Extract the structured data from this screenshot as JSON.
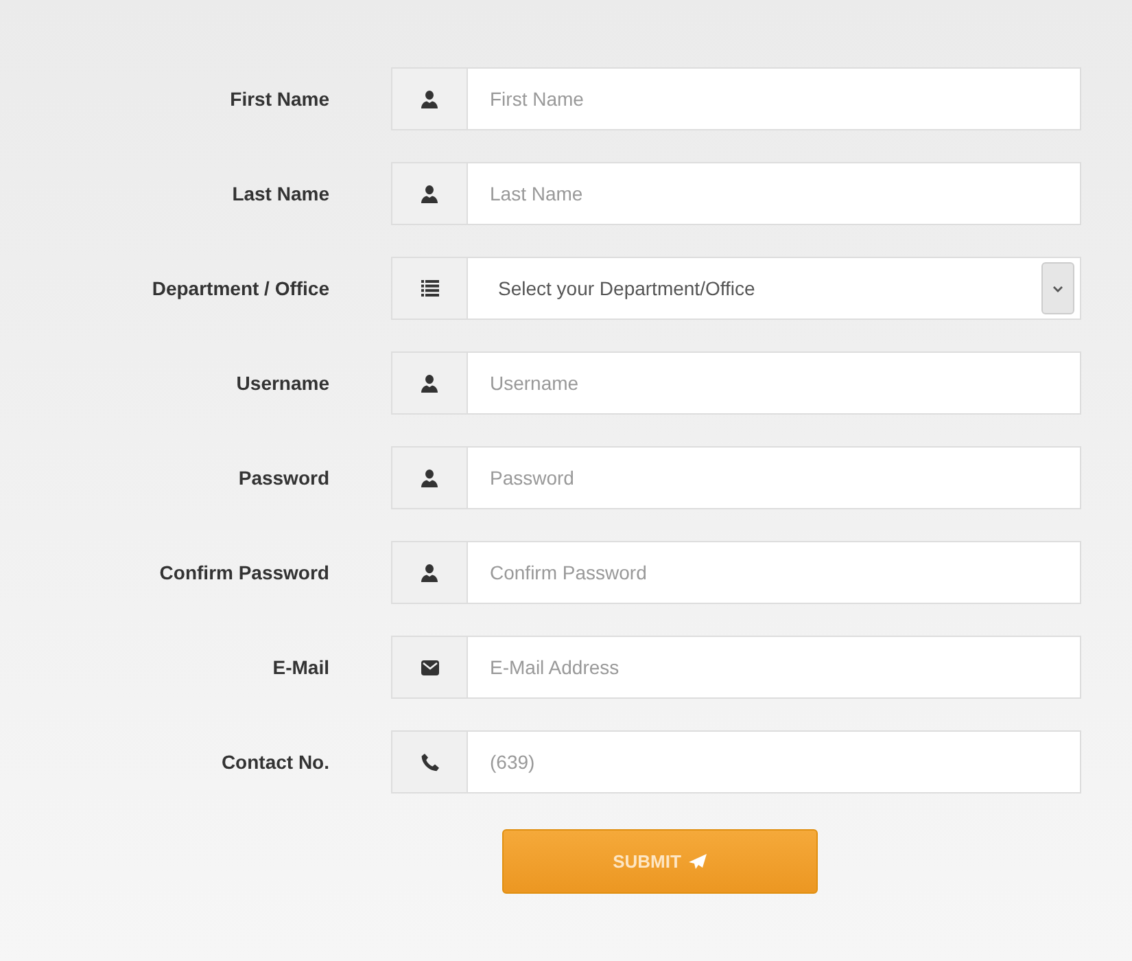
{
  "fields": [
    {
      "label": "First Name",
      "kind": "user",
      "placeholder": "First Name"
    },
    {
      "label": "Last Name",
      "kind": "user",
      "placeholder": "Last Name"
    },
    {
      "label": "Department / Office",
      "kind": "select",
      "placeholder": "Select your Department/Office"
    },
    {
      "label": "Username",
      "kind": "user",
      "placeholder": "Username"
    },
    {
      "label": "Password",
      "kind": "user",
      "placeholder": "Password"
    },
    {
      "label": "Confirm Password",
      "kind": "user",
      "placeholder": "Confirm Password"
    },
    {
      "label": "E-Mail",
      "kind": "mail",
      "placeholder": "E-Mail Address"
    },
    {
      "label": "Contact No.",
      "kind": "phone",
      "placeholder": "(639)"
    }
  ],
  "submit": {
    "label": "SUBMIT"
  }
}
